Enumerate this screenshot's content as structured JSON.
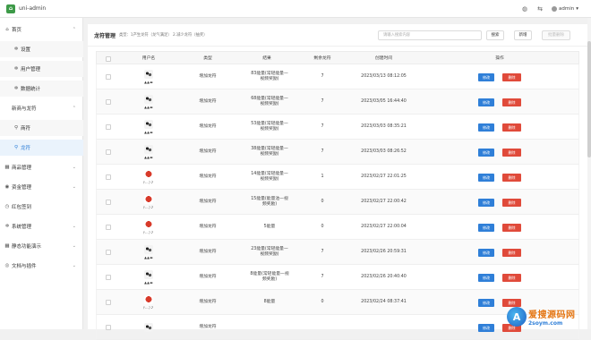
{
  "app": {
    "title": "uni-admin",
    "user": "admin"
  },
  "sidebar": {
    "items": [
      {
        "label": "首页",
        "icon": "home-icon"
      },
      {
        "label": "设置",
        "icon": "gear-icon"
      },
      {
        "label": "用户管理",
        "icon": "gear-icon"
      },
      {
        "label": "数据统计",
        "icon": "gear-icon"
      },
      {
        "label": "新商与龙符",
        "icon": ""
      },
      {
        "label": "商符",
        "icon": "location-icon"
      },
      {
        "label": "龙符",
        "icon": "location-icon"
      },
      {
        "label": "商品管理",
        "icon": "grid-icon"
      },
      {
        "label": "资金管理",
        "icon": "eye-icon"
      },
      {
        "label": "红包签到",
        "icon": "clock-icon"
      },
      {
        "label": "系统管理",
        "icon": "gear-icon"
      },
      {
        "label": "静态功能演示",
        "icon": "grid-icon"
      },
      {
        "label": "文档与插件",
        "icon": "circle-icon"
      }
    ]
  },
  "page": {
    "title": "龙符管理",
    "subtitle": "类型：1产生龙符（龙气满足）  2.减少龙符（抽奖）",
    "search_placeholder": "请输入搜索内容",
    "search_button": "搜索",
    "add_button": "新增",
    "batch_delete_button": "批量删除"
  },
  "table": {
    "headers": [
      "用户名",
      "类型",
      "结果",
      "剩余龙符",
      "创建时间",
      "操作"
    ],
    "edit_label": "修改",
    "delete_label": "删除",
    "rows": [
      {
        "name": "▲▲▬",
        "type": "增加龙符",
        "result": "83能量(常轻能量—视频奖励)",
        "remain": "7",
        "time": "2023/03/13 08:12:05"
      },
      {
        "name": "▲▲▬",
        "type": "增加龙符",
        "result": "68能量(常轻能量—视频奖励)",
        "remain": "7",
        "time": "2023/03/05 16:44:40"
      },
      {
        "name": "▲▲▬",
        "type": "增加龙符",
        "result": "53能量(常轻能量—视频奖励)",
        "remain": "7",
        "time": "2023/03/03 08:35:21"
      },
      {
        "name": "▲▲▬",
        "type": "增加龙符",
        "result": "38能量(常轻能量—视频奖励)",
        "remain": "7",
        "time": "2023/03/03 08:26:52"
      },
      {
        "name": "ﾃ…ﾌ㇇",
        "type": "增加龙符",
        "result": "14能量(常轻能量—视频奖励)",
        "remain": "1",
        "time": "2023/02/27 22:01:25"
      },
      {
        "name": "ﾃ…ﾌ㇇",
        "type": "增加龙符",
        "result": "15能量(能量池—视频奖励)",
        "remain": "0",
        "time": "2023/02/27 22:00:42"
      },
      {
        "name": "ﾃ…ﾌ㇇",
        "type": "增加龙符",
        "result": "5能量",
        "remain": "0",
        "time": "2023/02/27 22:00:04"
      },
      {
        "name": "▲▲▬",
        "type": "增加龙符",
        "result": "23能量(常轻能量—视频奖励)",
        "remain": "7",
        "time": "2023/02/26 20:59:31"
      },
      {
        "name": "▲▲▬",
        "type": "增加龙符",
        "result": "8能量(常轻能量—视频奖励)",
        "remain": "7",
        "time": "2023/02/26 20:40:40"
      },
      {
        "name": "ﾃ…ﾌ㇇",
        "type": "增加龙符",
        "result": "8能量",
        "remain": "0",
        "time": "2023/02/24 08:37:41"
      },
      {
        "name": "",
        "type": "增加龙符",
        "result": "",
        "remain": "",
        "time": ""
      }
    ]
  },
  "watermark": {
    "cn": "爱搜源码网",
    "en": "2soym.com",
    "logo": "A"
  },
  "colors": {
    "primary": "#2f7fd8",
    "danger": "#e04a3a",
    "brand": "#3d9a48"
  }
}
